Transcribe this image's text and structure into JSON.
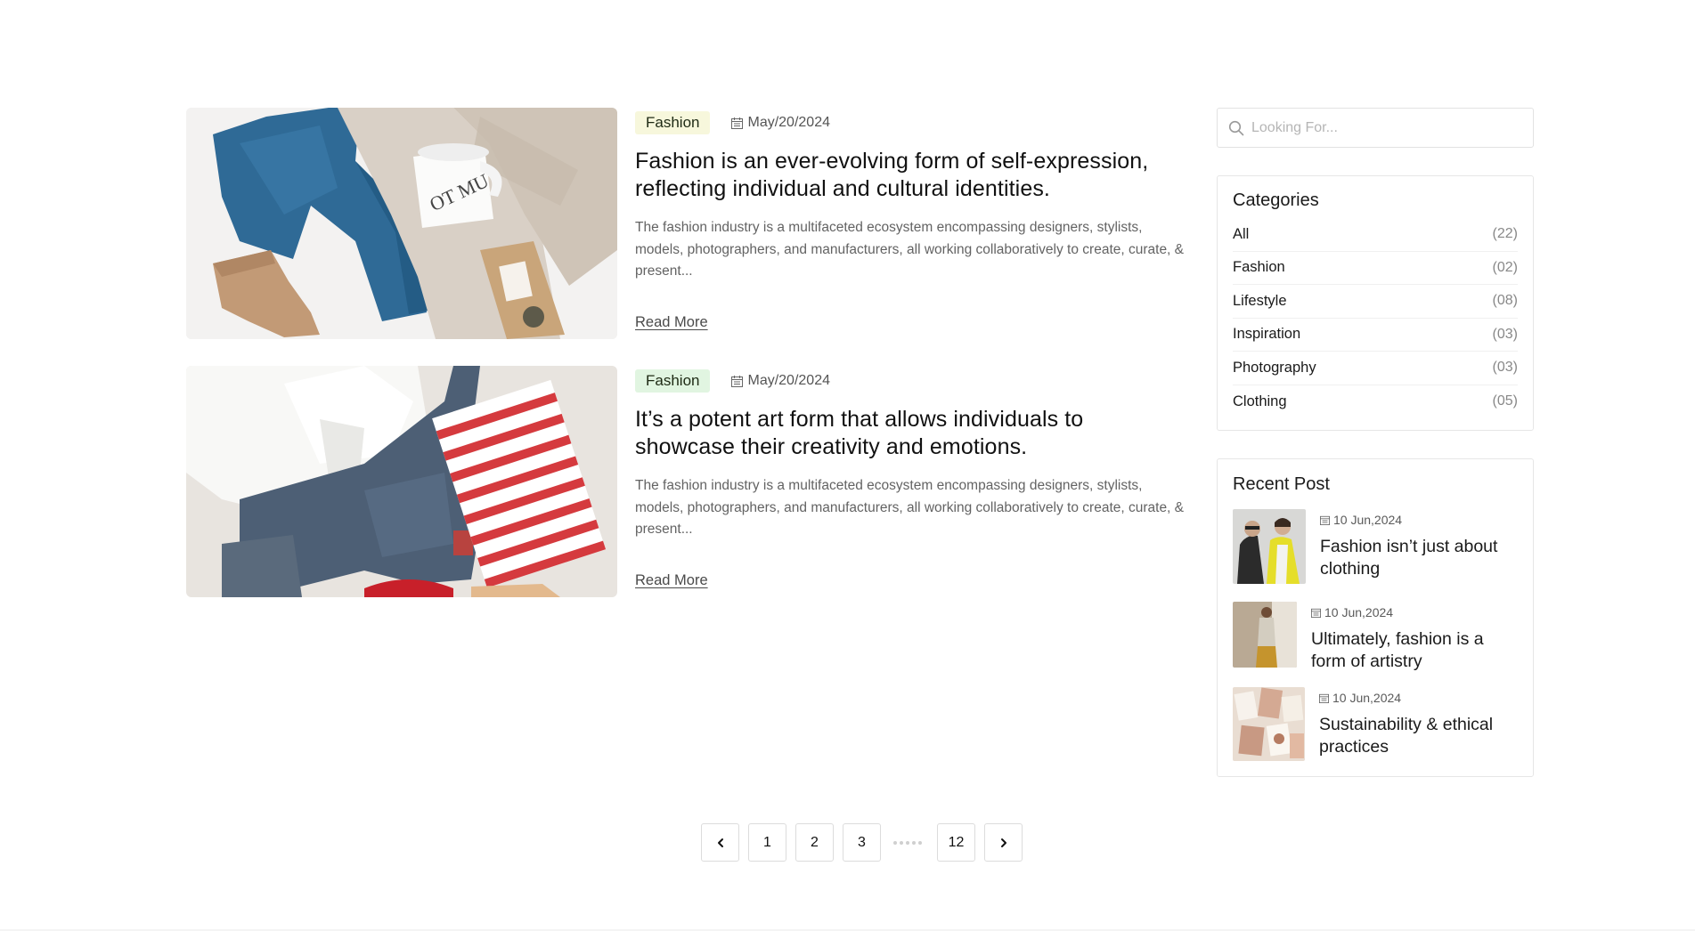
{
  "posts": [
    {
      "category": "Fashion",
      "date": "May/20/2024",
      "title": "Fashion is an ever-evolving form of self-expression, reflecting individual and cultural identities.",
      "excerpt": "The fashion industry is a multifaceted ecosystem encompassing designers, stylists, models, photographers, and manufacturers, all working collaboratively to create, curate, & present...",
      "read_more": "Read More"
    },
    {
      "category": "Fashion",
      "date": "May/20/2024",
      "title": "It’s a potent art form that allows individuals to showcase their creativity and emotions.",
      "excerpt": "The fashion industry is a multifaceted ecosystem encompassing designers, stylists, models, photographers, and manufacturers, all working collaboratively to create, curate, & present...",
      "read_more": "Read More"
    }
  ],
  "sidebar": {
    "search": {
      "placeholder": "Looking For...",
      "value": ""
    },
    "categories": {
      "title": "Categories",
      "items": [
        {
          "label": "All",
          "count": "(22)"
        },
        {
          "label": "Fashion",
          "count": "(02)"
        },
        {
          "label": "Lifestyle",
          "count": "(08)"
        },
        {
          "label": "Inspiration",
          "count": "(03)"
        },
        {
          "label": "Photography",
          "count": "(03)"
        },
        {
          "label": "Clothing",
          "count": "(05)"
        }
      ]
    },
    "recent": {
      "title": "Recent Post",
      "items": [
        {
          "date": "10 Jun,2024",
          "title": "Fashion isn’t just about clothing"
        },
        {
          "date": "10 Jun,2024",
          "title": "Ultimately, fashion is a form of artistry"
        },
        {
          "date": "10 Jun,2024",
          "title": "Sustainability & ethical practices"
        }
      ]
    }
  },
  "pagination": {
    "prev_icon": "chevron-left-icon",
    "pages": [
      "1",
      "2",
      "3"
    ],
    "last_page": "12",
    "next_icon": "chevron-right-icon"
  },
  "colors": {
    "tag_yellow": "#f7f7dc",
    "tag_green": "#e1f5e1",
    "border": "#e6e6e6"
  }
}
